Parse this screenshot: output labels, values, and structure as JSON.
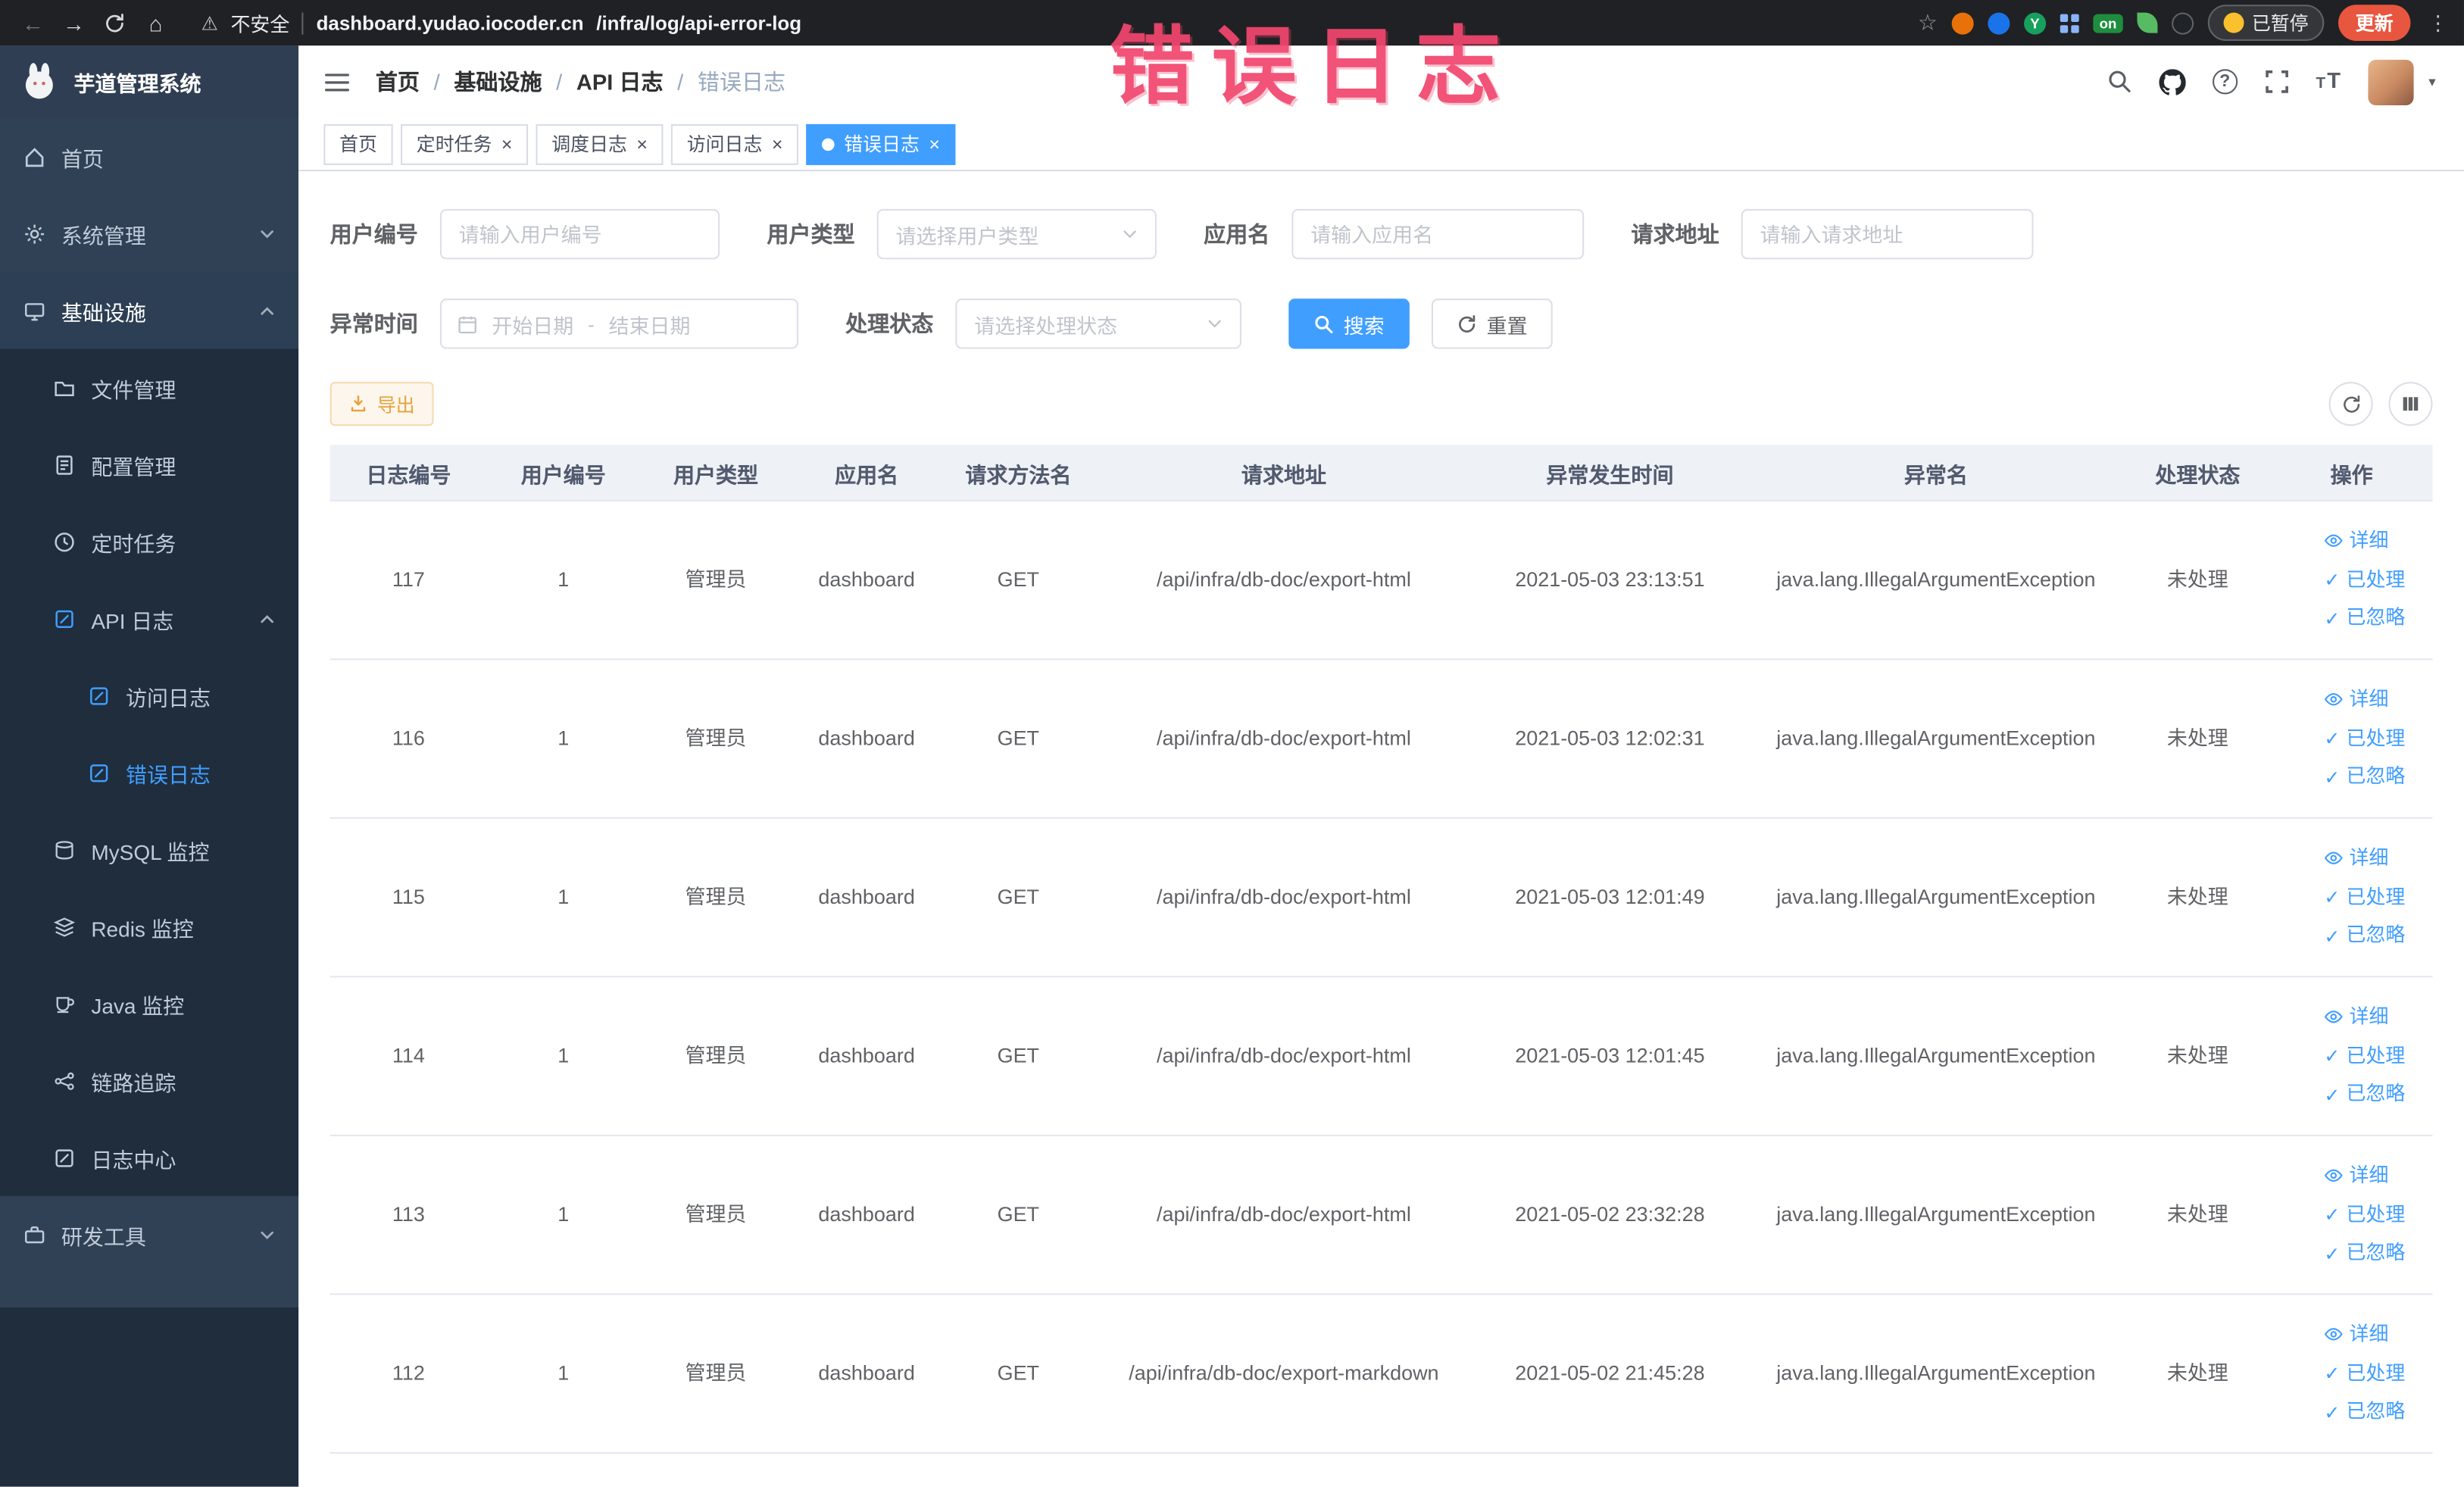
{
  "browser": {
    "security_label": "不安全",
    "url_host": "dashboard.yudao.iocoder.cn",
    "url_path": "/infra/log/api-error-log",
    "ext_y_label": "Y",
    "ext_on_label": "on",
    "paused_label": "已暂停",
    "update_label": "更新"
  },
  "annotation": {
    "title": "错误日志"
  },
  "sidebar": {
    "logo_title": "芋道管理系统",
    "items": [
      {
        "label": "首页"
      },
      {
        "label": "系统管理"
      },
      {
        "label": "基础设施"
      },
      {
        "label": "文件管理"
      },
      {
        "label": "配置管理"
      },
      {
        "label": "定时任务"
      },
      {
        "label": "API 日志"
      },
      {
        "label": "访问日志"
      },
      {
        "label": "错误日志"
      },
      {
        "label": "MySQL 监控"
      },
      {
        "label": "Redis 监控"
      },
      {
        "label": "Java 监控"
      },
      {
        "label": "链路追踪"
      },
      {
        "label": "日志中心"
      },
      {
        "label": "研发工具"
      }
    ]
  },
  "breadcrumb": {
    "items": [
      "首页",
      "基础设施",
      "API 日志",
      "错误日志"
    ]
  },
  "tabs": [
    {
      "label": "首页"
    },
    {
      "label": "定时任务"
    },
    {
      "label": "调度日志"
    },
    {
      "label": "访问日志"
    },
    {
      "label": "错误日志"
    }
  ],
  "filters": {
    "user_id_label": "用户编号",
    "user_id_placeholder": "请输入用户编号",
    "user_type_label": "用户类型",
    "user_type_placeholder": "请选择用户类型",
    "app_name_label": "应用名",
    "app_name_placeholder": "请输入应用名",
    "request_url_label": "请求地址",
    "request_url_placeholder": "请输入请求地址",
    "exception_time_label": "异常时间",
    "date_start_placeholder": "开始日期",
    "date_separator": "-",
    "date_end_placeholder": "结束日期",
    "process_status_label": "处理状态",
    "process_status_placeholder": "请选择处理状态",
    "search_label": "搜索",
    "reset_label": "重置"
  },
  "toolbar": {
    "export_label": "导出"
  },
  "table": {
    "columns": [
      "日志编号",
      "用户编号",
      "用户类型",
      "应用名",
      "请求方法名",
      "请求地址",
      "异常发生时间",
      "异常名",
      "处理状态",
      "操作"
    ],
    "actions": {
      "detail": "详细",
      "processed": "已处理",
      "ignored": "已忽略"
    },
    "rows": [
      {
        "log_id": "117",
        "user_id": "1",
        "user_type": "管理员",
        "app_name": "dashboard",
        "method": "GET",
        "url": "/api/infra/db-doc/export-html",
        "time": "2021-05-03 23:13:51",
        "exception": "java.lang.IllegalArgumentException",
        "status": "未处理"
      },
      {
        "log_id": "116",
        "user_id": "1",
        "user_type": "管理员",
        "app_name": "dashboard",
        "method": "GET",
        "url": "/api/infra/db-doc/export-html",
        "time": "2021-05-03 12:02:31",
        "exception": "java.lang.IllegalArgumentException",
        "status": "未处理"
      },
      {
        "log_id": "115",
        "user_id": "1",
        "user_type": "管理员",
        "app_name": "dashboard",
        "method": "GET",
        "url": "/api/infra/db-doc/export-html",
        "time": "2021-05-03 12:01:49",
        "exception": "java.lang.IllegalArgumentException",
        "status": "未处理"
      },
      {
        "log_id": "114",
        "user_id": "1",
        "user_type": "管理员",
        "app_name": "dashboard",
        "method": "GET",
        "url": "/api/infra/db-doc/export-html",
        "time": "2021-05-03 12:01:45",
        "exception": "java.lang.IllegalArgumentException",
        "status": "未处理"
      },
      {
        "log_id": "113",
        "user_id": "1",
        "user_type": "管理员",
        "app_name": "dashboard",
        "method": "GET",
        "url": "/api/infra/db-doc/export-html",
        "time": "2021-05-02 23:32:28",
        "exception": "java.lang.IllegalArgumentException",
        "status": "未处理"
      },
      {
        "log_id": "112",
        "user_id": "1",
        "user_type": "管理员",
        "app_name": "dashboard",
        "method": "GET",
        "url": "/api/infra/db-doc/export-markdown",
        "time": "2021-05-02 21:45:28",
        "exception": "java.lang.IllegalArgumentException",
        "status": "未处理"
      }
    ]
  },
  "colors": {
    "accent": "#409eff",
    "sidebar_bg": "#304156",
    "submenu_bg": "#1f2d3d",
    "warning": "#e6a23c",
    "annotation": "#f2466e"
  }
}
